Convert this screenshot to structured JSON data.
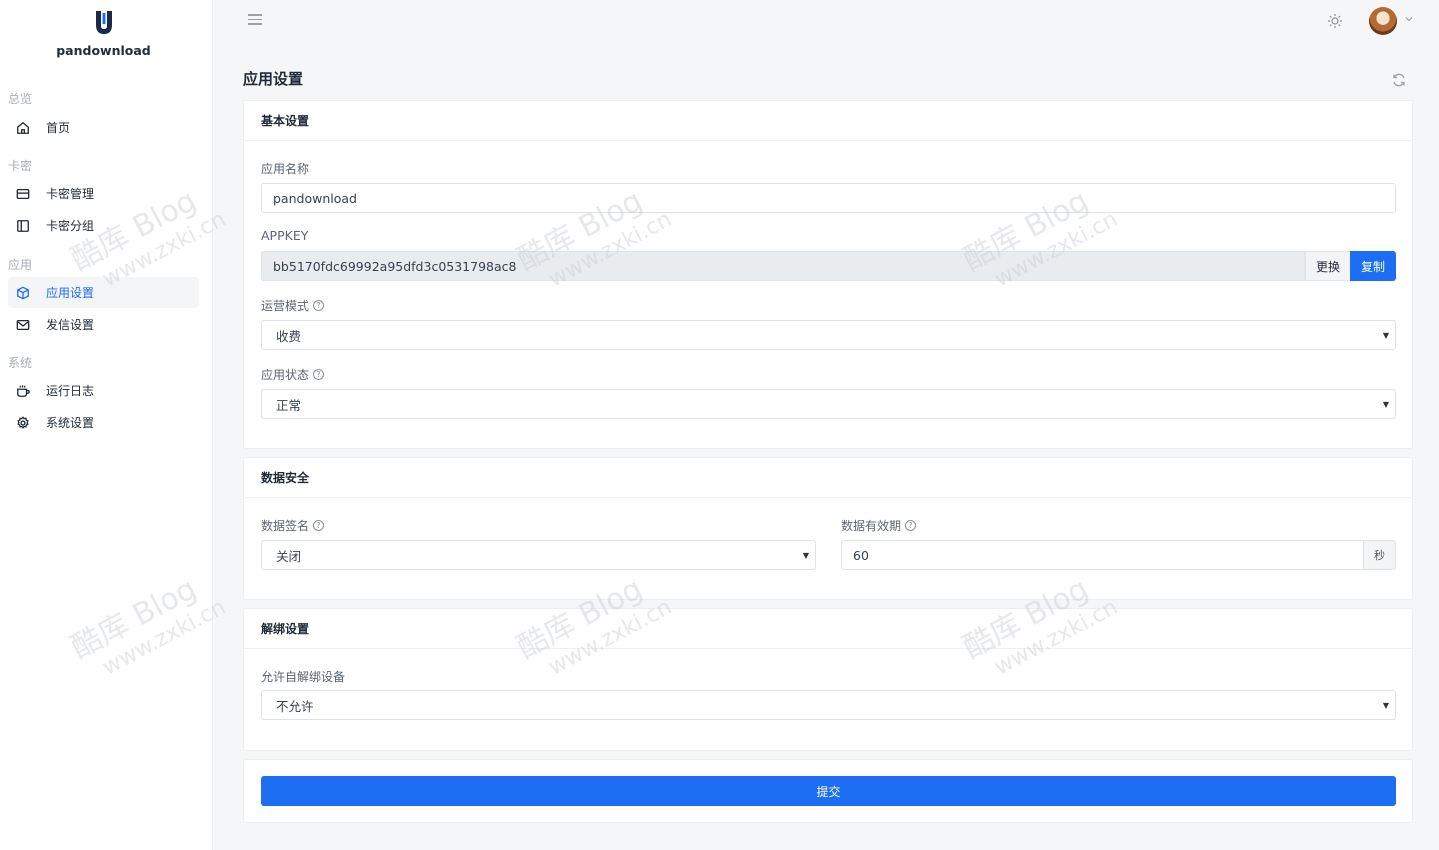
{
  "app": {
    "name": "pandownload"
  },
  "sidebar": {
    "groups": [
      {
        "title": "总览",
        "items": [
          {
            "label": "首页",
            "icon": "home-icon"
          }
        ]
      },
      {
        "title": "卡密",
        "items": [
          {
            "label": "卡密管理",
            "icon": "card-icon"
          },
          {
            "label": "卡密分组",
            "icon": "panel-icon"
          }
        ]
      },
      {
        "title": "应用",
        "items": [
          {
            "label": "应用设置",
            "icon": "cube-icon",
            "active": true
          },
          {
            "label": "发信设置",
            "icon": "mail-icon"
          }
        ]
      },
      {
        "title": "系统",
        "items": [
          {
            "label": "运行日志",
            "icon": "cup-icon"
          },
          {
            "label": "系统设置",
            "icon": "gear-icon"
          }
        ]
      }
    ]
  },
  "page": {
    "title": "应用设置"
  },
  "basic": {
    "title": "基本设置",
    "app_name_label": "应用名称",
    "app_name_value": "pandownload",
    "appkey_label": "APPKEY",
    "appkey_value": "bb5170fdc69992a95dfd3c0531798ac8",
    "replace_label": "更换",
    "copy_label": "复制",
    "mode_label": "运营模式",
    "mode_value": "收费",
    "status_label": "应用状态",
    "status_value": "正常"
  },
  "security": {
    "title": "数据安全",
    "sign_label": "数据签名",
    "sign_value": "关闭",
    "ttl_label": "数据有效期",
    "ttl_value": "60",
    "ttl_unit": "秒"
  },
  "unbind": {
    "title": "解绑设置",
    "allow_label": "允许自解绑设备",
    "allow_value": "不允许"
  },
  "submit_label": "提交",
  "watermark": {
    "line1": "酷库 Blog",
    "line2": "www.zxki.cn"
  },
  "colors": {
    "primary": "#1d6ef3",
    "background": "#f5f6f8"
  }
}
